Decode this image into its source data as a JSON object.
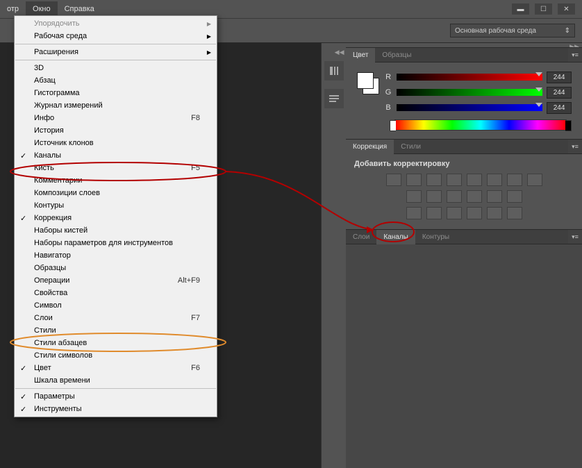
{
  "menubar": {
    "truncated": "отр",
    "window": "Окно",
    "help": "Справка"
  },
  "workspace_selector": "Основная рабочая среда",
  "window_menu": [
    {
      "label": "Упорядочить",
      "sub": true,
      "disabled": true
    },
    {
      "label": "Рабочая среда",
      "sub": true
    },
    {
      "sep": true
    },
    {
      "label": "Расширения",
      "sub": true
    },
    {
      "sep": true
    },
    {
      "label": "3D"
    },
    {
      "label": "Абзац"
    },
    {
      "label": "Гистограмма"
    },
    {
      "label": "Журнал измерений"
    },
    {
      "label": "Инфо",
      "shortcut": "F8"
    },
    {
      "label": "История"
    },
    {
      "label": "Источник клонов"
    },
    {
      "label": "Каналы",
      "checked": true
    },
    {
      "label": "Кисть",
      "shortcut": "F5"
    },
    {
      "label": "Комментарии"
    },
    {
      "label": "Композиции слоев"
    },
    {
      "label": "Контуры"
    },
    {
      "label": "Коррекция",
      "checked": true
    },
    {
      "label": "Наборы кистей"
    },
    {
      "label": "Наборы параметров для инструментов"
    },
    {
      "label": "Навигатор"
    },
    {
      "label": "Образцы"
    },
    {
      "label": "Операции",
      "shortcut": "Alt+F9"
    },
    {
      "label": "Свойства"
    },
    {
      "label": "Символ"
    },
    {
      "label": "Слои",
      "shortcut": "F7"
    },
    {
      "label": "Стили"
    },
    {
      "label": "Стили абзацев"
    },
    {
      "label": "Стили символов"
    },
    {
      "label": "Цвет",
      "checked": true,
      "shortcut": "F6"
    },
    {
      "label": "Шкала времени"
    },
    {
      "sep": true
    },
    {
      "label": "Параметры",
      "checked": true
    },
    {
      "label": "Инструменты",
      "checked": true
    }
  ],
  "panels": {
    "color_tab": "Цвет",
    "swatches_tab": "Образцы",
    "r_label": "R",
    "g_label": "G",
    "b_label": "B",
    "r_val": "244",
    "g_val": "244",
    "b_val": "244",
    "corr_tab": "Коррекция",
    "styles_tab": "Стили",
    "add_adjustment": "Добавить корректировку",
    "layers_tab": "Слои",
    "channels_tab": "Каналы",
    "paths_tab": "Контуры"
  }
}
